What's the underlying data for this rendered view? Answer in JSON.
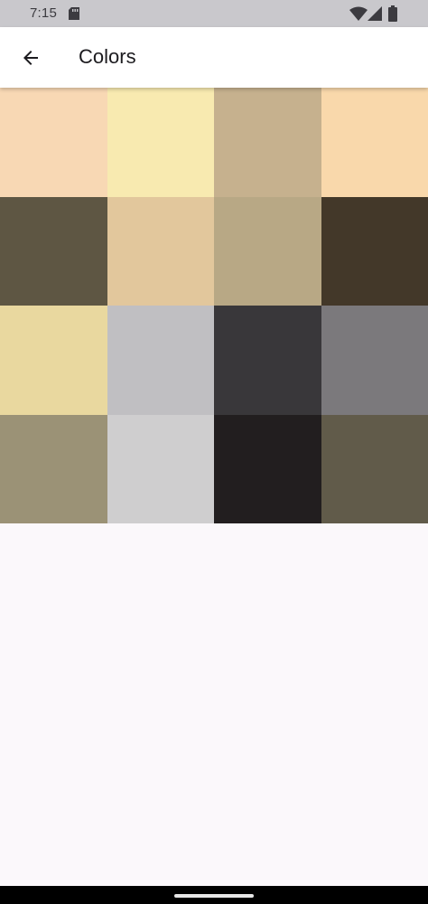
{
  "status_bar": {
    "time": "7:15",
    "icons": [
      "sd-card-icon",
      "wifi-icon",
      "signal-icon",
      "battery-icon"
    ]
  },
  "app_bar": {
    "title": "Colors",
    "back_icon": "arrow-back-icon"
  },
  "colors": {
    "text_primary": "#1c1b1f",
    "background": "#fbf8fb",
    "status_bar_bg": "#c9c8cc",
    "swatches": [
      "#f8d8b4",
      "#f8eab0",
      "#c6b18e",
      "#f9d8ab",
      "#5e5643",
      "#e2c79c",
      "#b8a885",
      "#433829",
      "#e9d89f",
      "#c0bfc2",
      "#39373a",
      "#7b797c",
      "#9b9276",
      "#cfcecf",
      "#221e1f",
      "#615b4a"
    ]
  }
}
